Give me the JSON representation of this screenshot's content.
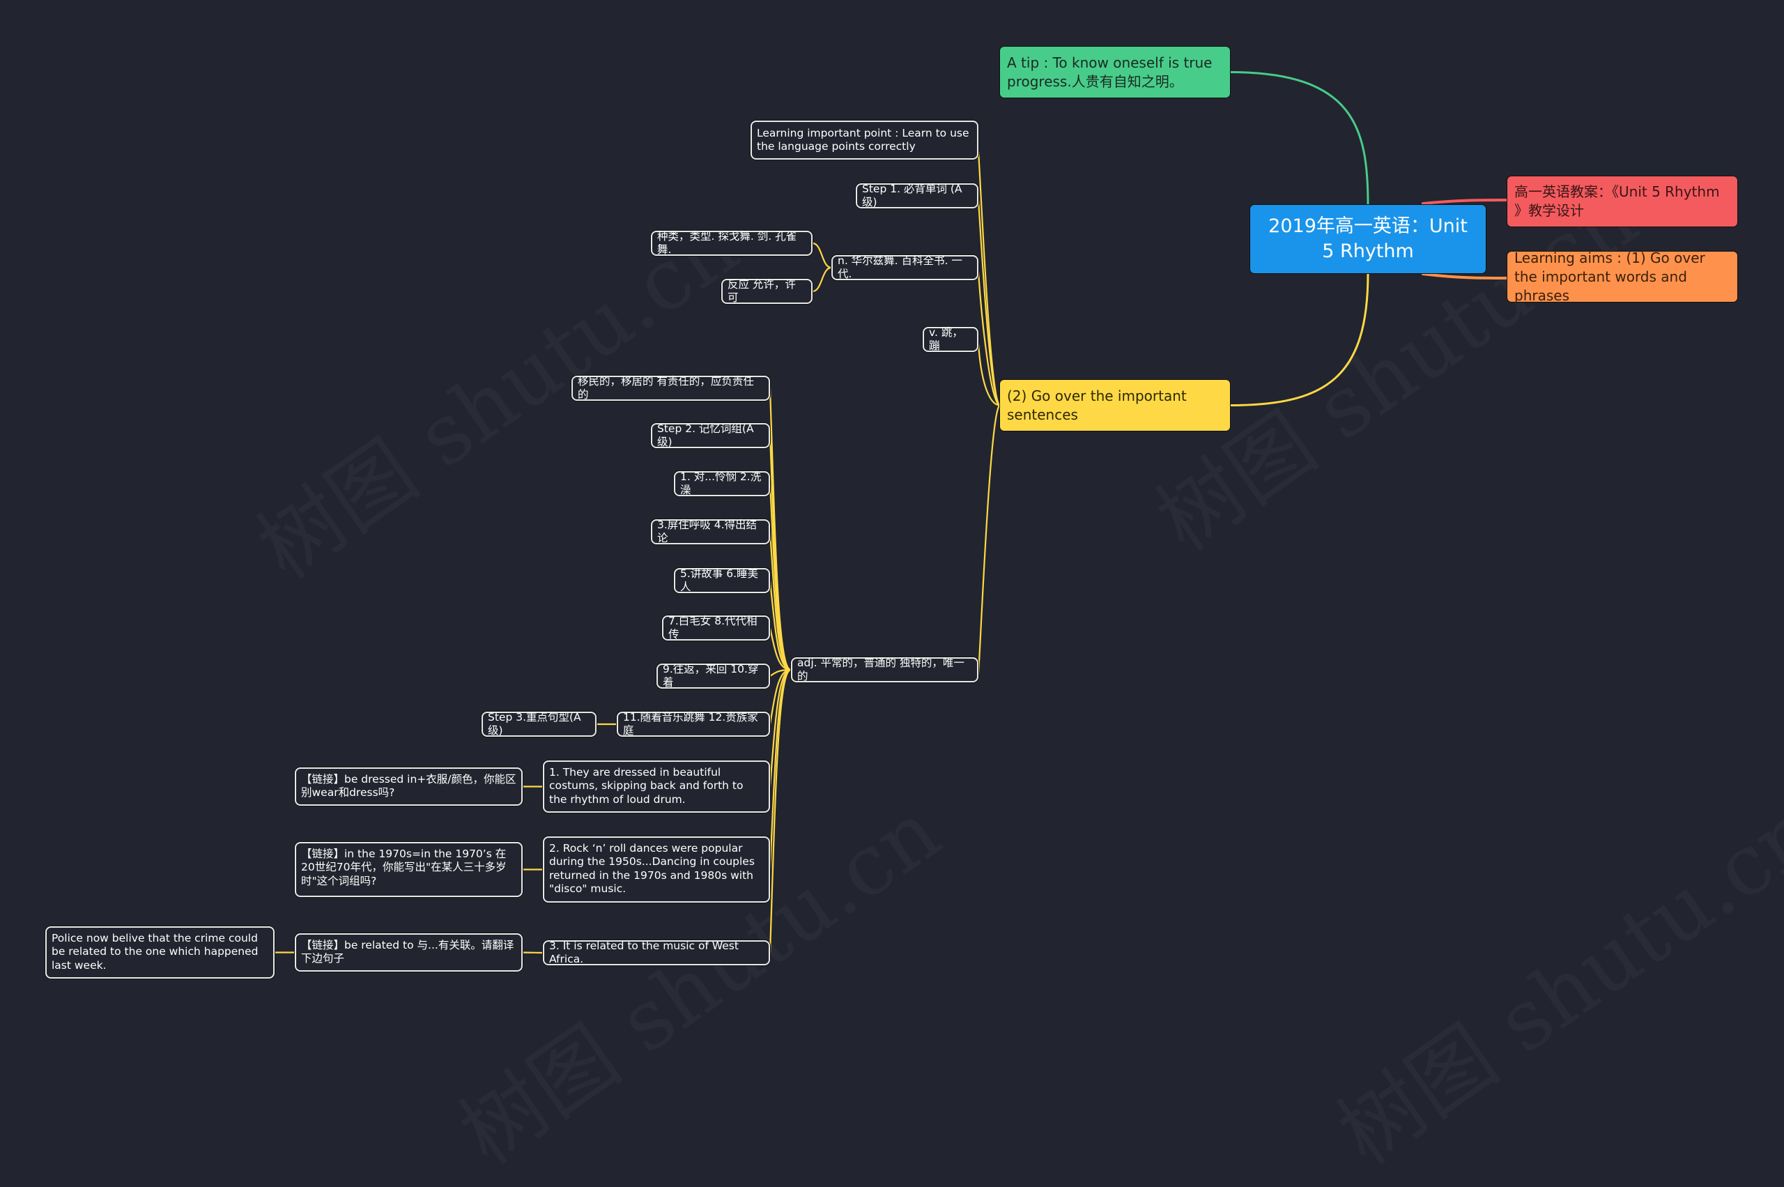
{
  "watermark": "树图 shutu.cn",
  "colors": {
    "background": "#22252f",
    "root": "#1a94ea",
    "green": "#48cc8a",
    "red": "#f45b5e",
    "orange": "#fe924c",
    "yellow": "#fed945",
    "leaf_border": "#e8e8e8"
  },
  "root": {
    "title": "2019年高一英语：Unit 5 Rhythm"
  },
  "branches": {
    "tip": "A tip : To know oneself is true progress.人贵有自知之明。",
    "plan": "高一英语教案：《Unit 5 Rhythm 》教学设计",
    "aims": "Learning aims : (1) Go over the important words and phrases",
    "sentences": "(2) Go over the important sentences"
  },
  "sentences_children": {
    "learning_point": "Learning important point : Learn to use the language points correctly",
    "step1": "Step 1. 必背单词 (A级)",
    "noun": "n. 华尔兹舞. 百科全书. 一代.",
    "noun_children": [
      "种类，类型. 探戈舞. 剑. 孔雀舞.",
      "反应 允许，许可"
    ],
    "verb": "v. 跳，蹦",
    "adj": "adj. 平常的，普通的 独特的，唯一的"
  },
  "adj_children": {
    "items": [
      "移民的，移居的 有责任的，应负责任的",
      "Step 2. 记忆词组(A级)",
      "1. 对...怜悯 2.洗澡",
      "3.屏住呼吸 4.得出结论",
      "5.讲故事 6.睡美人",
      "7.白毛女 8.代代相传",
      "9.往返，来回 10.穿着",
      "11.随着音乐跳舞 12.贵族家庭"
    ],
    "step3": "Step 3.重点句型(A级)",
    "sentence1": "1. They are dressed in beautiful costums, skipping back and forth to the rhythm of loud drum.",
    "link1": "【链接】be dressed in+衣服/颜色，你能区别wear和dress吗?",
    "sentence2": "2. Rock ‘n’ roll dances were popular during the 1950s...Dancing in couples returned in the 1970s and 1980s with \"disco\" music.",
    "link2": "【链接】in the 1970s=in the 1970’s 在20世纪70年代，你能写出\"在某人三十多岁时\"这个词组吗?",
    "sentence3": "3. It is related to the music of West Africa.",
    "link3": "【链接】be related to 与...有关联。请翻译下边句子",
    "link3_child": "Police now belive that the crime could be  related to the one which happened last week."
  }
}
